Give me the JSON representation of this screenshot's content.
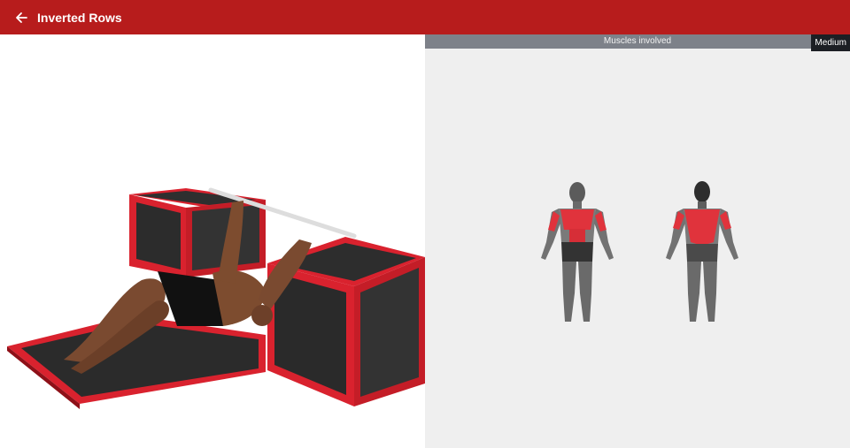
{
  "header": {
    "title": "Inverted Rows",
    "back_icon": "arrow-left-icon"
  },
  "muscles": {
    "label": "Muscles involved",
    "level": "Medium"
  },
  "colors": {
    "appbar": "#b71c1c",
    "muscle_highlight": "#e0333c",
    "panel_bg": "#efefef"
  }
}
